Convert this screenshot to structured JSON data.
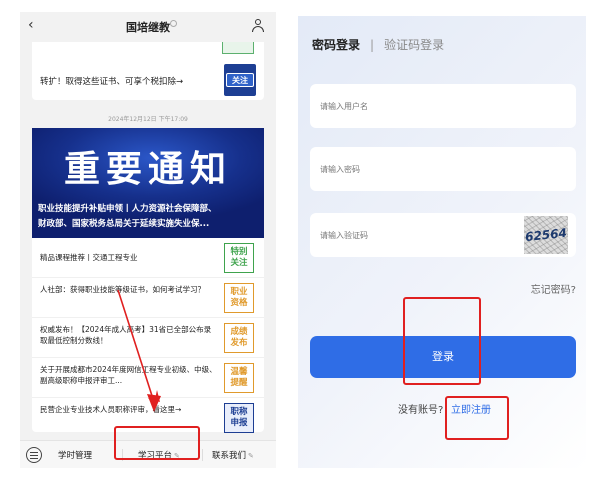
{
  "left": {
    "header": {
      "back_icon": "back-arrow-icon",
      "title": "国培继教",
      "user_icon": "user-icon"
    },
    "card1": {
      "text": "转扩！取得这些证书、可享个税扣除→",
      "badge": "关注"
    },
    "timestamp": "2024年12月12日 下午17:09",
    "banner": {
      "headline": "重要通知",
      "sub_line1": "职业技能提升补贴申领丨人力资源社会保障部、",
      "sub_line2": "财政部、国家税务总局关于延续实施失业保..."
    },
    "items": [
      {
        "text": "精品课程推荐丨交通工程专业",
        "tag": "特别关注",
        "tag_color": "#3fa34d"
      },
      {
        "text": "人社部：获得职业技能等级证书，如何考试学习？",
        "tag": "职业资格",
        "tag_color": "#e09a2c"
      },
      {
        "text": "权威发布！【2024年成人高考】31省已全部公布录取最低控制分数线！",
        "tag": "成绩发布",
        "tag_color": "#e09a2c"
      },
      {
        "text": "关于开展成都市2024年度网信工程专业初级、中级、副高级职称申报评审工...",
        "tag": "温馨提醒",
        "tag_color": "#e09a2c"
      },
      {
        "text": "民营企业专业技术人员职称评审，看这里→",
        "tag": "职称申报",
        "tag_color": "#1d3e93"
      }
    ],
    "bottom_nav": {
      "menu_icon": "menu-icon",
      "tab1": "学时管理",
      "tab2": "学习平台",
      "tab3": "联系我们"
    }
  },
  "right": {
    "tab_password": "密码登录",
    "tab_divider": "|",
    "tab_sms": "验证码登录",
    "username_placeholder": "请输入用户名",
    "password_placeholder": "请输入密码",
    "captcha_placeholder": "请输入验证码",
    "captcha_code": "62564",
    "forgot": "忘记密码?",
    "login_button": "登录",
    "no_account": "没有账号?",
    "register": "立即注册"
  },
  "colors": {
    "accent_blue": "#2f6de6",
    "annotation_red": "#e02020",
    "banner_navy": "#0e1f6e"
  }
}
